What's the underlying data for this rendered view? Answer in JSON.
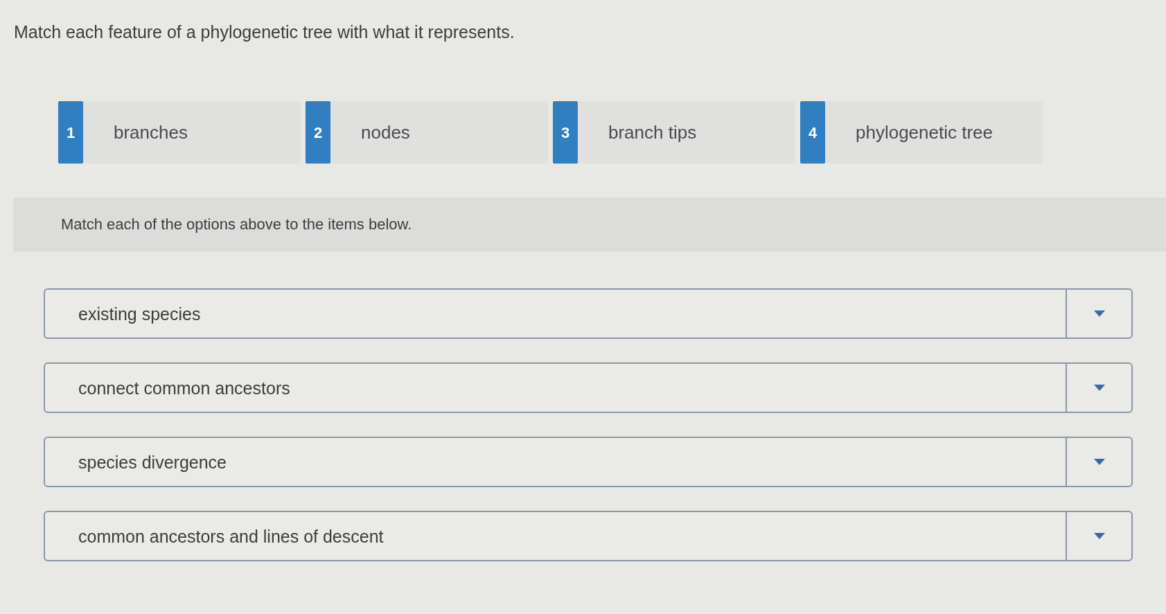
{
  "prompt": "Match each feature of a phylogenetic tree with what it represents.",
  "options": [
    {
      "number": "1",
      "label": "branches"
    },
    {
      "number": "2",
      "label": "nodes"
    },
    {
      "number": "3",
      "label": "branch tips"
    },
    {
      "number": "4",
      "label": "phylogenetic tree"
    }
  ],
  "instructions": "Match each of the options above to the items below.",
  "items": [
    {
      "text": "existing species"
    },
    {
      "text": "connect common ancestors"
    },
    {
      "text": "species divergence"
    },
    {
      "text": "common ancestors and lines of descent"
    }
  ]
}
